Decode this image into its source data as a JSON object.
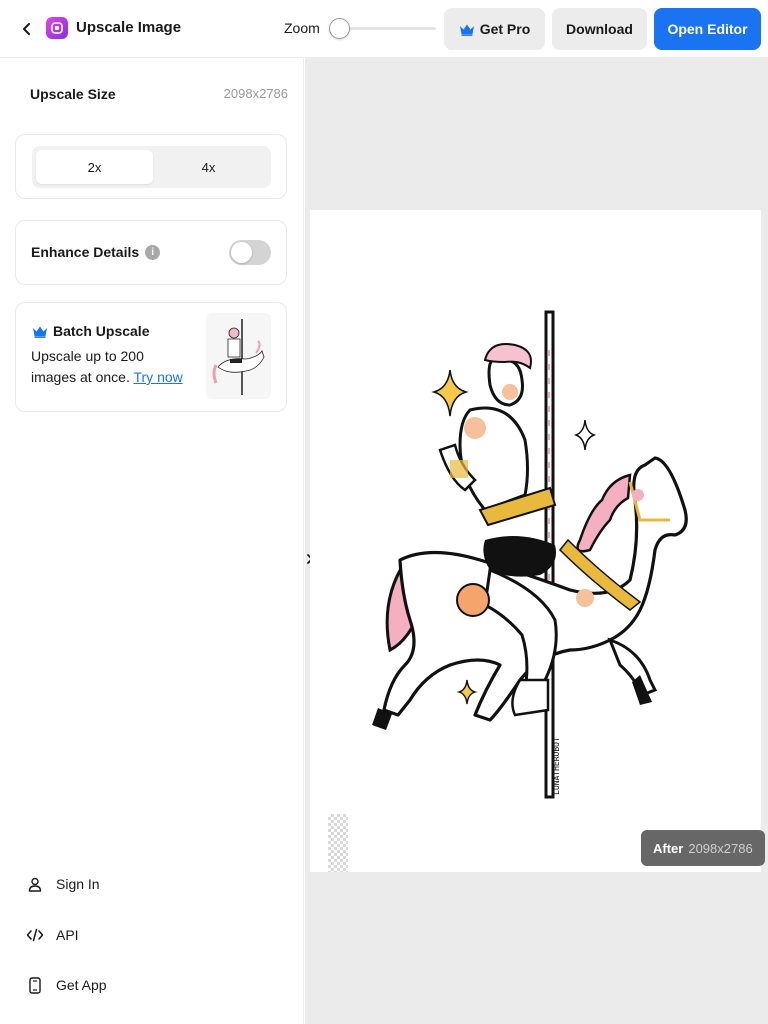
{
  "header": {
    "title": "Upscale Image",
    "zoom_label": "Zoom",
    "zoom_level": 0.08,
    "get_pro_label": "Get Pro",
    "download_label": "Download",
    "open_editor_label": "Open Editor"
  },
  "sidebar": {
    "upscale_size_label": "Upscale Size",
    "upscale_size_value": "2098x2786",
    "scale_options": [
      "2x",
      "4x"
    ],
    "selected_scale": "2x",
    "enhance_label": "Enhance Details",
    "enhance_enabled": false,
    "batch": {
      "title": "Batch Upscale",
      "description": "Upscale up to 200 images at once.",
      "link_label": "Try now"
    },
    "nav": [
      {
        "label": "Sign In",
        "icon": "user-icon"
      },
      {
        "label": "API",
        "icon": "code-icon"
      },
      {
        "label": "Get App",
        "icon": "phone-icon"
      }
    ]
  },
  "canvas": {
    "badge_label": "After",
    "badge_size": "2098x2786",
    "artwork_signature": "LUNATHEROBOT"
  },
  "colors": {
    "accent": "#1a73f0",
    "app_icon": "#b03adf",
    "button_gray": "#ececec",
    "canvas_bg": "#ebebeb"
  }
}
